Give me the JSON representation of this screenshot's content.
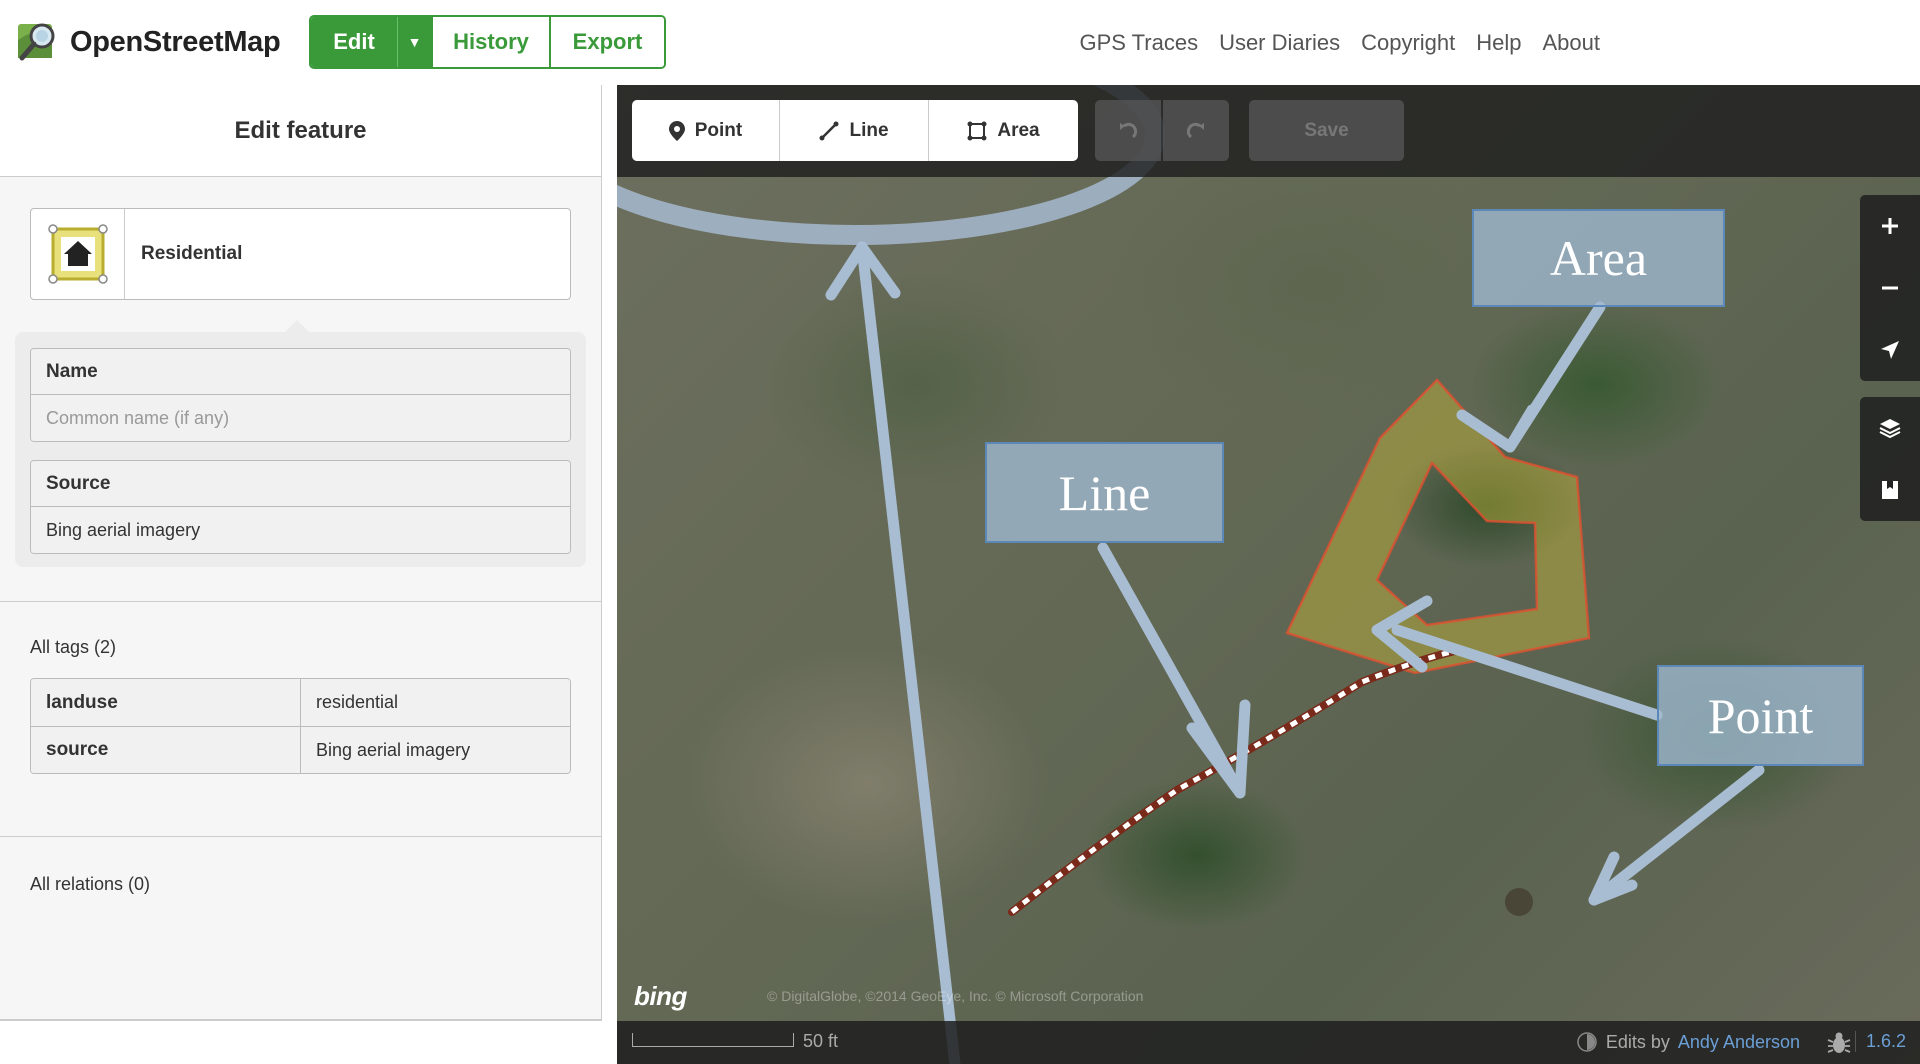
{
  "header": {
    "brand": "OpenStreetMap",
    "tabs": {
      "edit": "Edit",
      "history": "History",
      "export": "Export"
    },
    "nav": [
      "GPS Traces",
      "User Diaries",
      "Copyright",
      "Help",
      "About"
    ]
  },
  "sidebar": {
    "title": "Edit feature",
    "preset": {
      "name": "Residential",
      "icon": "residential-house-icon"
    },
    "fields": {
      "name": {
        "label": "Name",
        "value": "",
        "placeholder": "Common name (if any)"
      },
      "source": {
        "label": "Source",
        "value": "Bing aerial imagery"
      }
    },
    "all_tags_label": "All tags (2)",
    "tags": [
      {
        "key": "landuse",
        "value": "residential"
      },
      {
        "key": "source",
        "value": "Bing aerial imagery"
      }
    ],
    "all_relations_label": "All relations (0)"
  },
  "toolbar": {
    "modes": {
      "point": "Point",
      "line": "Line",
      "area": "Area"
    },
    "save": "Save"
  },
  "map": {
    "callouts": {
      "area": "Area",
      "line": "Line",
      "point": "Point"
    },
    "imagery_logo": "bing",
    "attribution": "© DigitalGlobe, ©2014 GeoEye, Inc. © Microsoft Corporation",
    "scale_label": "50 ft",
    "edits_by_prefix": "Edits by",
    "edits_by_user": "Andy Anderson",
    "version": "1.6.2"
  },
  "colors": {
    "brand_green": "#3a9a3a",
    "callout_fill": "#a0bad2",
    "callout_border": "#5b88b8",
    "area_fill": "#c8b83a",
    "area_stroke": "#e05030",
    "link_blue": "#6b9fd6"
  }
}
